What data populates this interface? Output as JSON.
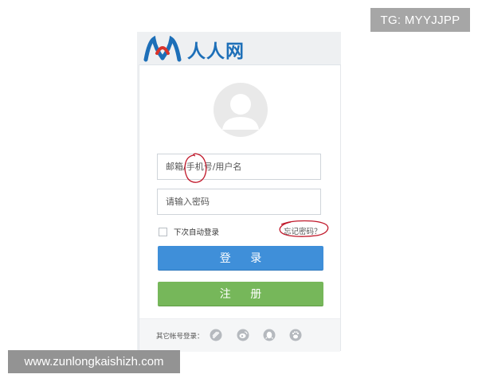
{
  "brand": {
    "name": "人人网"
  },
  "login": {
    "account_placeholder": "邮箱/手机号/用户名",
    "password_placeholder": "请输入密码",
    "remember_label": "下次自动登录",
    "forgot_link": "忘记密码？",
    "login_button": "登 录",
    "register_button": "注 册"
  },
  "other_login": {
    "label": "其它帐号登录：",
    "icons": [
      "social-login-icon",
      "weibo-icon",
      "qq-icon",
      "baidu-icon"
    ]
  },
  "watermarks": {
    "top_right": "TG: MYYJJPP",
    "bottom_left": "www.zunlongkaishizh.com"
  },
  "colors": {
    "brand_blue": "#1d6fb8",
    "login_button": "#3f8fd9",
    "register_button": "#76b75a",
    "annotation_red": "#c0182a"
  }
}
